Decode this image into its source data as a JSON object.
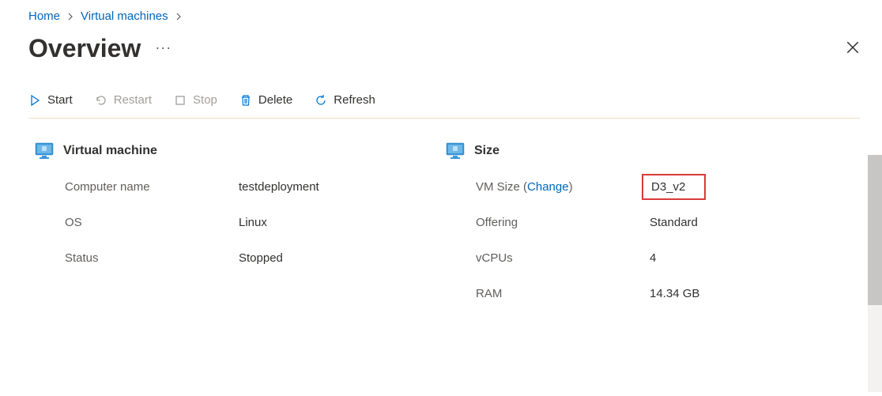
{
  "breadcrumb": {
    "home": "Home",
    "vms": "Virtual machines"
  },
  "title": "Overview",
  "toolbar": {
    "start": "Start",
    "restart": "Restart",
    "stop": "Stop",
    "delete": "Delete",
    "refresh": "Refresh"
  },
  "sections": {
    "vm": {
      "title": "Virtual machine",
      "computer_name": {
        "label": "Computer name",
        "value": "testdeployment"
      },
      "os": {
        "label": "OS",
        "value": "Linux"
      },
      "status": {
        "label": "Status",
        "value": "Stopped"
      }
    },
    "size": {
      "title": "Size",
      "vm_size": {
        "label": "VM Size",
        "change": "Change",
        "value": "D3_v2"
      },
      "offering": {
        "label": "Offering",
        "value": "Standard"
      },
      "vcpus": {
        "label": "vCPUs",
        "value": "4"
      },
      "ram": {
        "label": "RAM",
        "value": "14.34 GB"
      }
    }
  }
}
